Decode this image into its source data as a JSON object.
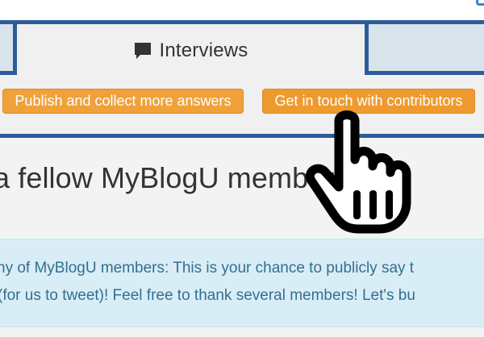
{
  "tabs": {
    "active": {
      "label": "Interviews",
      "icon": "chat-bubble-icon"
    }
  },
  "actions": {
    "publish_label": "Publish and collect more answers",
    "contact_label": "Get in touch with contributors"
  },
  "main": {
    "heading": "a fellow MyBlogU members"
  },
  "info": {
    "line1": "ny of MyBlogU members: This is your chance to publicly say t",
    "line2": "(for us to tweet)! Feel free to thank several members! Let's bu"
  },
  "colors": {
    "tab_border": "#2c5c9b",
    "button": "#f0a13a",
    "info_bg": "#d9edf7",
    "info_text": "#31708f"
  },
  "cursor": {
    "icon": "pointing-hand-cursor-icon"
  }
}
